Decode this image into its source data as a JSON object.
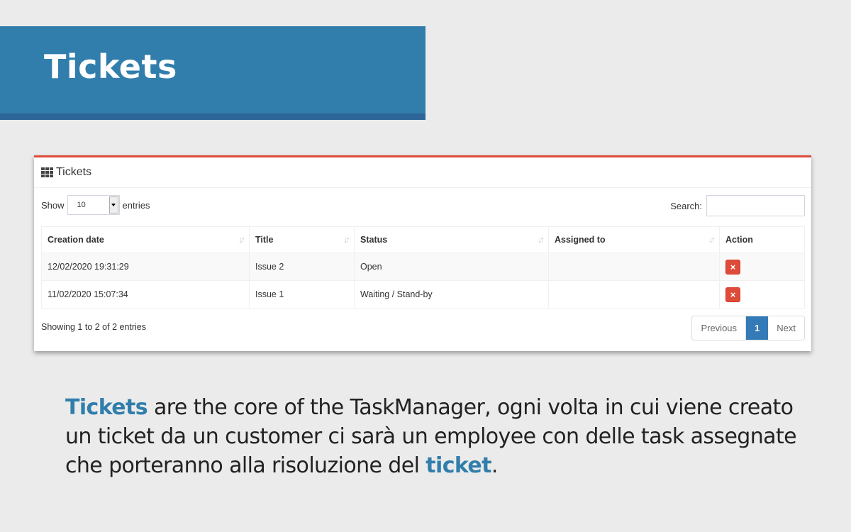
{
  "banner": {
    "title": "Tickets"
  },
  "box": {
    "title": "Tickets",
    "icon": "th-grid-icon",
    "length_label_pre": "Show",
    "length_value": "10",
    "length_label_post": "entries",
    "search_label": "Search:",
    "search_value": "",
    "columns": [
      "Creation date",
      "Title",
      "Status",
      "Assigned to",
      "Action"
    ],
    "rows": [
      {
        "creation_date": "12/02/2020 19:31:29",
        "title": "Issue 2",
        "status": "Open",
        "assigned_to": "",
        "action": "×"
      },
      {
        "creation_date": "11/02/2020 15:07:34",
        "title": "Issue 1",
        "status": "Waiting / Stand-by",
        "assigned_to": "",
        "action": "×"
      }
    ],
    "info": "Showing 1 to 2 of 2 entries",
    "pagination": {
      "previous": "Previous",
      "current": "1",
      "next": "Next"
    },
    "colors": {
      "accent_top": "#dd4b39",
      "delete_button": "#dd4b39",
      "page_active": "#337ab7"
    }
  },
  "description": {
    "highlight_start": "Tickets",
    "body": " are the core of the TaskManager, ogni volta in cui viene creato un ticket da un customer ci sarà un employee con delle task assegnate che porteranno alla risoluzione del ",
    "highlight_end": "ticket",
    "end": "."
  },
  "colors": {
    "banner": "#317eac",
    "banner_stripe": "#2e6599",
    "background": "#ebebeb"
  }
}
